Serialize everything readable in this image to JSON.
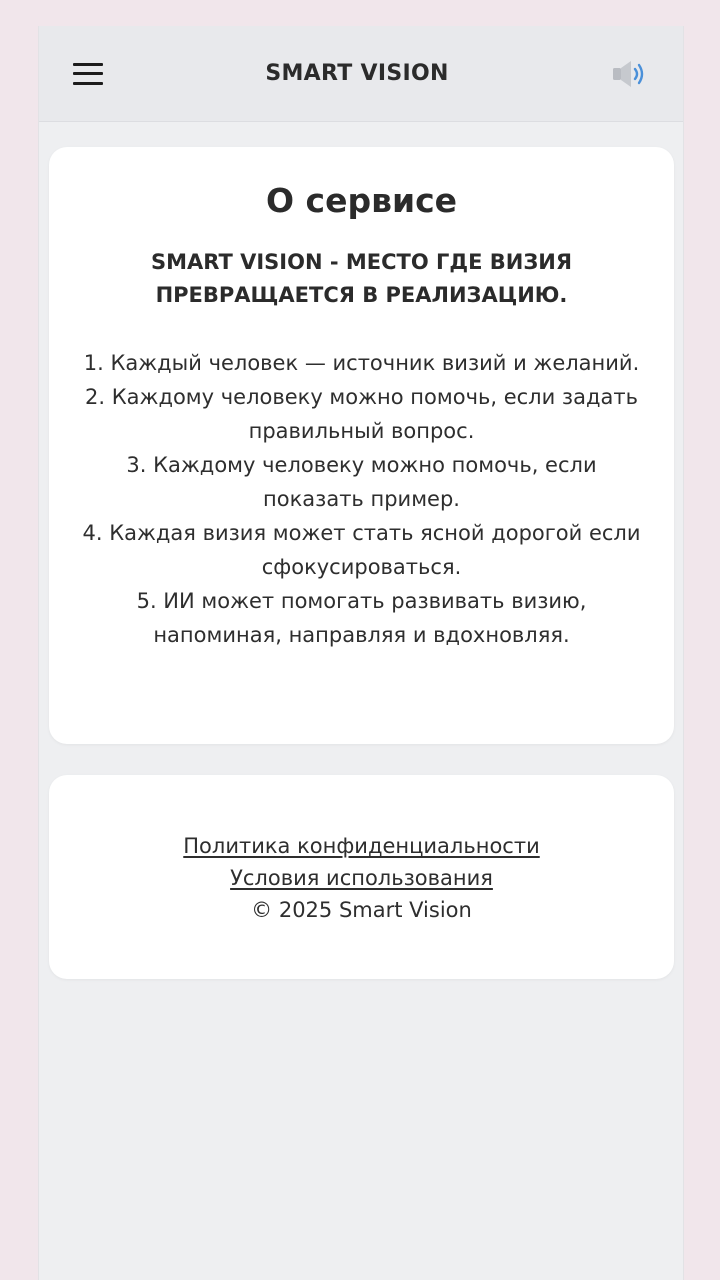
{
  "header": {
    "title": "SMART VISION",
    "menu_icon": "hamburger-menu-icon",
    "sound_icon": "speaker-icon"
  },
  "about": {
    "title": "О сервисе",
    "tagline": "SMART VISION - МЕСТО ГДЕ ВИЗИЯ ПРЕВРАЩАЕТСЯ В РЕАЛИЗАЦИЮ.",
    "items": [
      "1. Каждый человек — источник визий и желаний.",
      "2. Каждому человеку можно помочь, если задать правильный вопрос.",
      "3. Каждому человеку можно помочь, если показать пример.",
      "4. Каждая визия может стать ясной дорогой если сфокусироваться.",
      "5. ИИ может помогать развивать визию, напоминая, направляя и вдохновляя."
    ]
  },
  "footer": {
    "privacy_label": "Политика конфиденциальности",
    "terms_label": "Условия использования",
    "copyright": "© 2025 Smart Vision"
  },
  "colors": {
    "page_background": "#f1e6eb",
    "app_background": "#eeeff1",
    "header_background": "#e8e9ec",
    "card_background": "#ffffff",
    "sound_accent": "#4a90d9"
  }
}
